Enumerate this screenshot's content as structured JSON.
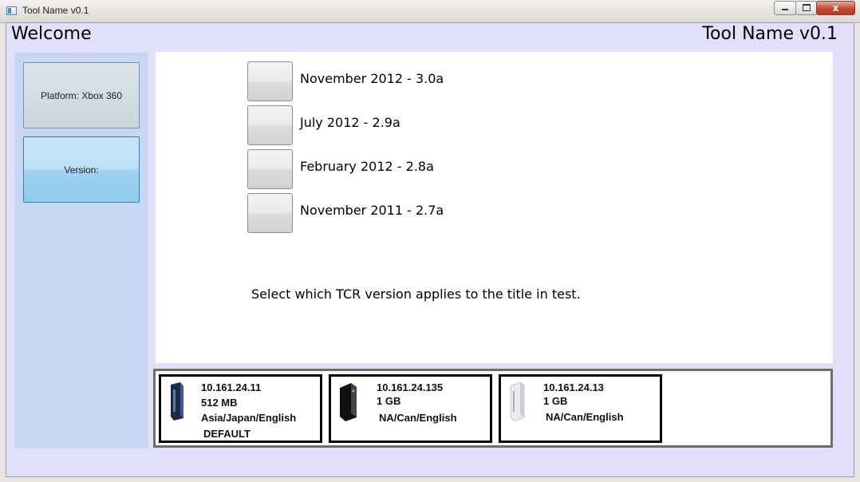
{
  "window": {
    "title": "Tool Name v0.1",
    "minimize_label": "",
    "maximize_label": "",
    "close_label": "x"
  },
  "header": {
    "welcome": "Welcome",
    "tool_name": "Tool Name v0.1"
  },
  "sidebar": {
    "platform_label": "Platform: Xbox 360",
    "version_label": "Version:"
  },
  "versions": [
    {
      "label": "November 2012 - 3.0a"
    },
    {
      "label": "July 2012 - 2.9a"
    },
    {
      "label": "February 2012 - 2.8a"
    },
    {
      "label": "November 2011 - 2.7a"
    }
  ],
  "hint": "Select which TCR version applies to the title in test.",
  "consoles": [
    {
      "ip": "10.161.24.11",
      "memory": "512 MB",
      "region": "Asia/Japan/English",
      "tag": "DEFAULT",
      "icon": "xbox-360-elite-icon"
    },
    {
      "ip": "10.161.24.135",
      "memory": "1 GB",
      "region": "NA/Can/English",
      "icon": "xbox-360-s-icon"
    },
    {
      "ip": "10.161.24.13",
      "memory": "1 GB",
      "region": "NA/Can/English",
      "icon": "xbox-360-white-icon"
    }
  ],
  "colors": {
    "client_bg": "#e1e0fb",
    "sidebar_bg": "#c5d7f3",
    "selected_button": "#9fd3ef"
  }
}
